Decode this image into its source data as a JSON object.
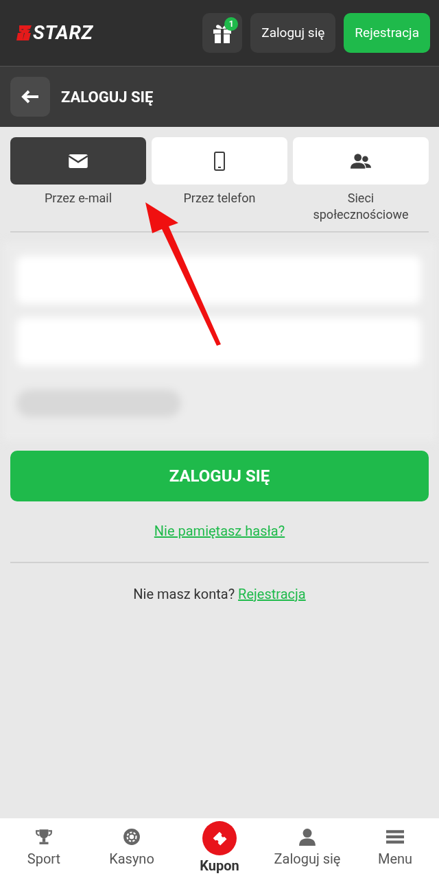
{
  "header": {
    "logo_text": "STARZ",
    "gift_badge": "1",
    "login_button": "Zaloguj się",
    "register_button": "Rejestracja"
  },
  "page_title": "ZALOGUJ SIĘ",
  "methods": [
    {
      "label": "Przez e-mail",
      "selected": true
    },
    {
      "label": "Przez telefon",
      "selected": false
    },
    {
      "label": "Sieci społecznościowe",
      "selected": false
    }
  ],
  "submit_button": "ZALOGUJ SIĘ",
  "forgot_link": "Nie pamiętasz hasła?",
  "signup_prompt": {
    "text": "Nie masz konta?",
    "link": "Rejestracja"
  },
  "bottom_nav": [
    {
      "label": "Sport",
      "kind": "plain"
    },
    {
      "label": "Kasyno",
      "kind": "plain"
    },
    {
      "label": "Kupon",
      "kind": "featured"
    },
    {
      "label": "Zaloguj się",
      "kind": "plain"
    },
    {
      "label": "Menu",
      "kind": "plain"
    }
  ]
}
